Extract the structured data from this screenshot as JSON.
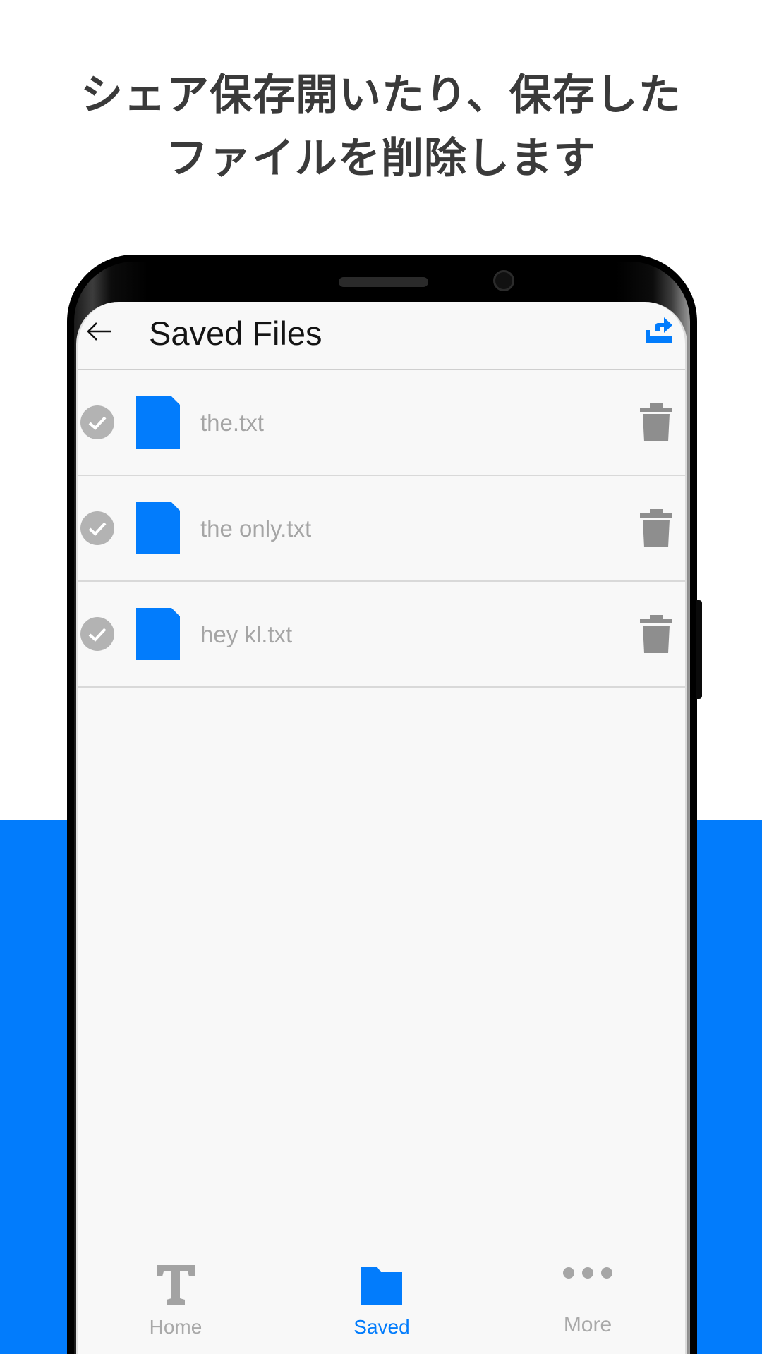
{
  "headline": {
    "line1": "シェア保存開いたり、保存した",
    "line2": "ファイルを削除します"
  },
  "appbar": {
    "back_icon": "arrow-left-icon",
    "title": "Saved Files",
    "share_icon": "share-export-icon"
  },
  "files": [
    {
      "name": "the.txt"
    },
    {
      "name": "the only.txt"
    },
    {
      "name": "hey kl.txt"
    }
  ],
  "bottom_nav": {
    "items": [
      {
        "label": "Home",
        "icon": "text-t-icon",
        "active": false
      },
      {
        "label": "Saved",
        "icon": "folder-icon",
        "active": true
      },
      {
        "label": "More",
        "icon": "more-dots-icon",
        "active": false
      }
    ]
  },
  "colors": {
    "accent": "#027cfc",
    "headline_text": "#3a3a3a",
    "inactive_icon": "#a0a0a0",
    "trash_icon": "#8e8e8e"
  }
}
